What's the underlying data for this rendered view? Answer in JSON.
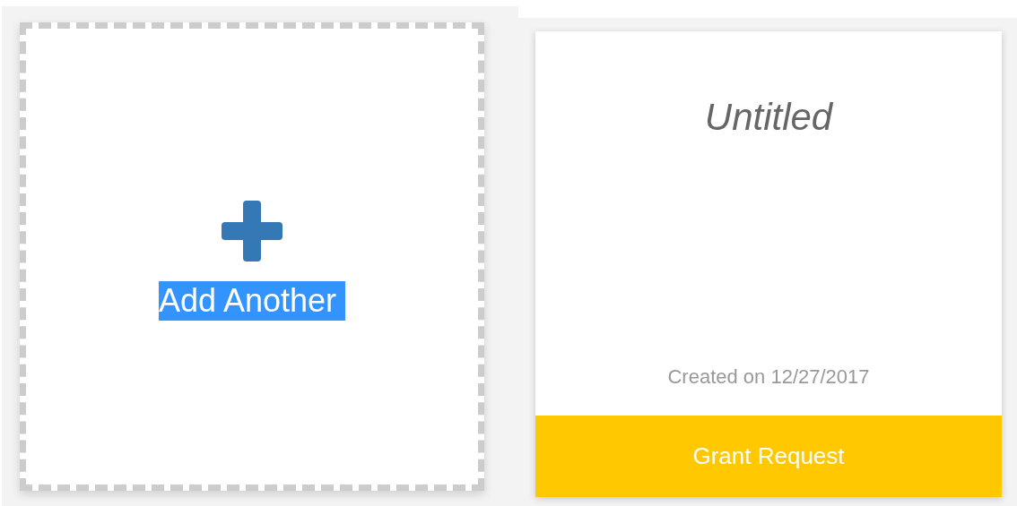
{
  "add_card": {
    "label": "Add Another",
    "highlighted": true
  },
  "cards": [
    {
      "title": "Untitled",
      "created": "Created on 12/27/2017",
      "action": "Grant Request"
    }
  ]
}
